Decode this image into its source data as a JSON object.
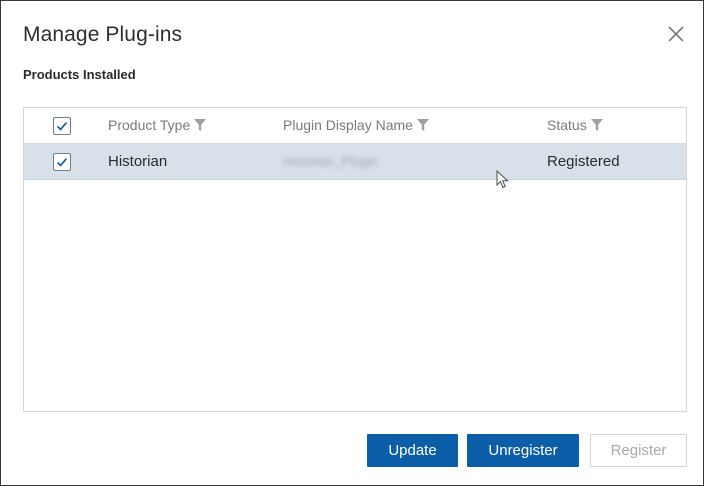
{
  "dialog": {
    "title": "Manage Plug-ins",
    "section_label": "Products Installed"
  },
  "table": {
    "columns": [
      {
        "label": "Product Type",
        "filter_icon": "filter-icon"
      },
      {
        "label": "Plugin Display Name",
        "filter_icon": "filter-icon"
      },
      {
        "label": "Status",
        "filter_icon": "filter-icon"
      }
    ],
    "header_checked": true,
    "rows": [
      {
        "checked": true,
        "selected": true,
        "product_type": "Historian",
        "plugin_display_name": "Historian_Plugin",
        "status": "Registered"
      }
    ]
  },
  "buttons": {
    "update": "Update",
    "unregister": "Unregister",
    "register": "Register"
  },
  "colors": {
    "primary": "#0d5ea8",
    "row_selected": "#d8e1ea",
    "border": "#d6d6d6"
  }
}
